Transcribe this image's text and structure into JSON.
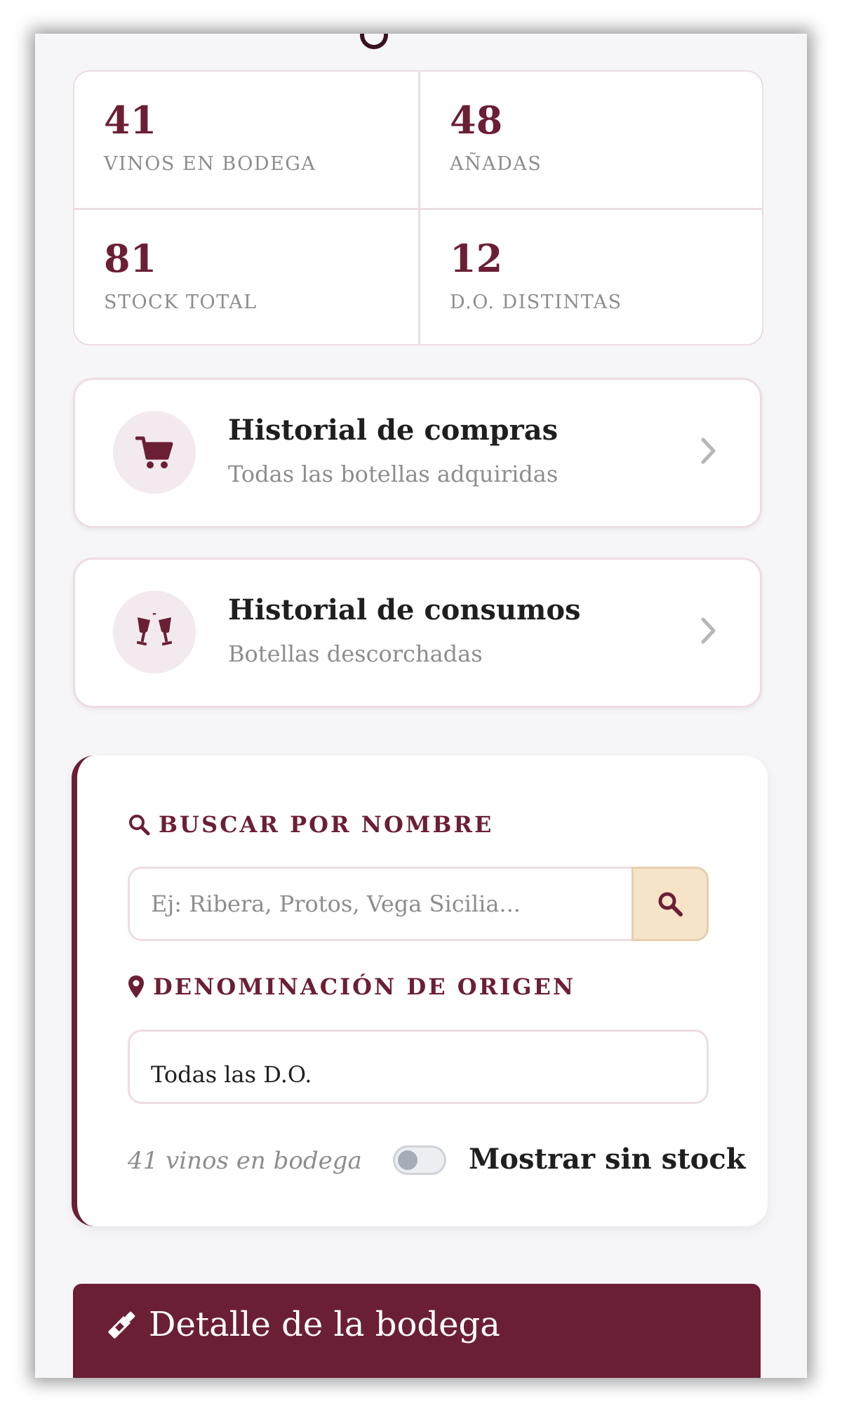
{
  "stats": [
    {
      "value": "41",
      "label": "VINOS EN BODEGA"
    },
    {
      "value": "48",
      "label": "AÑADAS"
    },
    {
      "value": "81",
      "label": "STOCK TOTAL"
    },
    {
      "value": "12",
      "label": "D.O. DISTINTAS"
    }
  ],
  "history": [
    {
      "title": "Historial de compras",
      "subtitle": "Todas las botellas adquiridas",
      "icon": "cart-icon"
    },
    {
      "title": "Historial de consumos",
      "subtitle": "Botellas descorchadas",
      "icon": "wine-glasses-icon"
    }
  ],
  "filters": {
    "search_label": "BUSCAR POR NOMBRE",
    "search_placeholder": "Ej: Ribera, Protos, Vega Sicilia...",
    "do_label": "DENOMINACIÓN DE ORIGEN",
    "do_selected": "Todas las D.O.",
    "count_text": "41 vinos en bodega",
    "toggle_label": "Mostrar sin stock",
    "toggle_on": false
  },
  "detail": {
    "title": "Detalle de la bodega",
    "icon": "wine-bottle-icon"
  },
  "colors": {
    "accent": "#6b1f35",
    "button_bg": "#f6e4c8",
    "page_bg": "#f6f6f9",
    "muted_text": "#8d8d8d"
  }
}
